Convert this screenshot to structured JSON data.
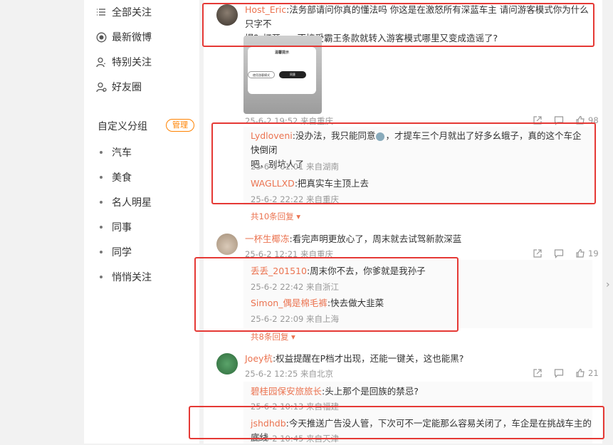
{
  "sidebar": {
    "nav": [
      {
        "label": "全部关注",
        "icon": "list-icon"
      },
      {
        "label": "最新微博",
        "icon": "radio-icon"
      },
      {
        "label": "特别关注",
        "icon": "user-star-icon"
      },
      {
        "label": "好友圈",
        "icon": "user-ring-icon"
      }
    ],
    "group_title": "自定义分组",
    "manage_label": "管理",
    "groups": [
      "汽车",
      "美食",
      "名人明星",
      "同事",
      "同学",
      "悄悄关注"
    ]
  },
  "posts": [
    {
      "user": "Host_Eric",
      "text": ":法务部请问你真的懂法吗 你这是在激怒所有深蓝车主 请问游客模式你为什么只字不提？打开app不接受霸王条款就转入游客模式哪里又变成造谣了?",
      "text_line1": ":法务部请问你真的懂法吗 你这是在激怒所有深蓝车主 请问游客模式你为什么只字不",
      "text_line2": "提？打开app不接受霸王条款就转入游客模式哪里又变成造谣了?",
      "image_title": "温馨提示",
      "image_btn1": "使用游客模式",
      "image_btn2": "同意",
      "meta": "25-6-2 19:52 来自重庆",
      "like_count": "98",
      "replies": [
        {
          "user": "Lydloveni",
          "text": ":没办法，我只能同意",
          "text_after": "，才提车三个月就出了好多幺蛾子，真的这个车企快倒闭",
          "text_line2": "吧，别坑人了",
          "meta": "25-6-3 01:01 来自湖南"
        },
        {
          "user": "WAGLLXD",
          "text": ":把真实车主顶上去",
          "meta": "25-6-2 22:22 来自重庆"
        }
      ],
      "more_replies": "共10条回复"
    },
    {
      "user": "一杯生椰冻",
      "text": ":看完声明更放心了，周末就去试驾新款深蓝",
      "meta": "25-6-2 12:21 来自重庆",
      "like_count": "19",
      "replies": [
        {
          "user": "丢丢_201510",
          "text": ":周末你不去，你爹就是我孙子",
          "meta": "25-6-2 22:42 来自浙江"
        },
        {
          "user": "Simon_偶是棉毛裤",
          "text": ":快去做大韭菜",
          "meta": "25-6-2 22:09 来自上海"
        }
      ],
      "more_replies": "共8条回复"
    },
    {
      "user": "Joey杭",
      "text": ":权益提醒在P档才出现，还能一键关，这也能黑?",
      "meta": "25-6-2 12:25 来自北京",
      "like_count": "21",
      "replies": [
        {
          "user": "碧桂园保安旅旅长",
          "text": ":头上那个是回族的禁忌?",
          "meta": "25-6-2 10:13 来自福建"
        },
        {
          "user": "jshdhdb",
          "text": ":今天推送广告没人管，下次可不一定能那么容易关闭了，车企是在挑战车主的底线",
          "meta": "25-6-2 10:45 来自天津"
        }
      ]
    }
  ],
  "colors": {
    "accent": "#ff8200",
    "username": "#eb7350",
    "highlight_box": "#e53935"
  }
}
